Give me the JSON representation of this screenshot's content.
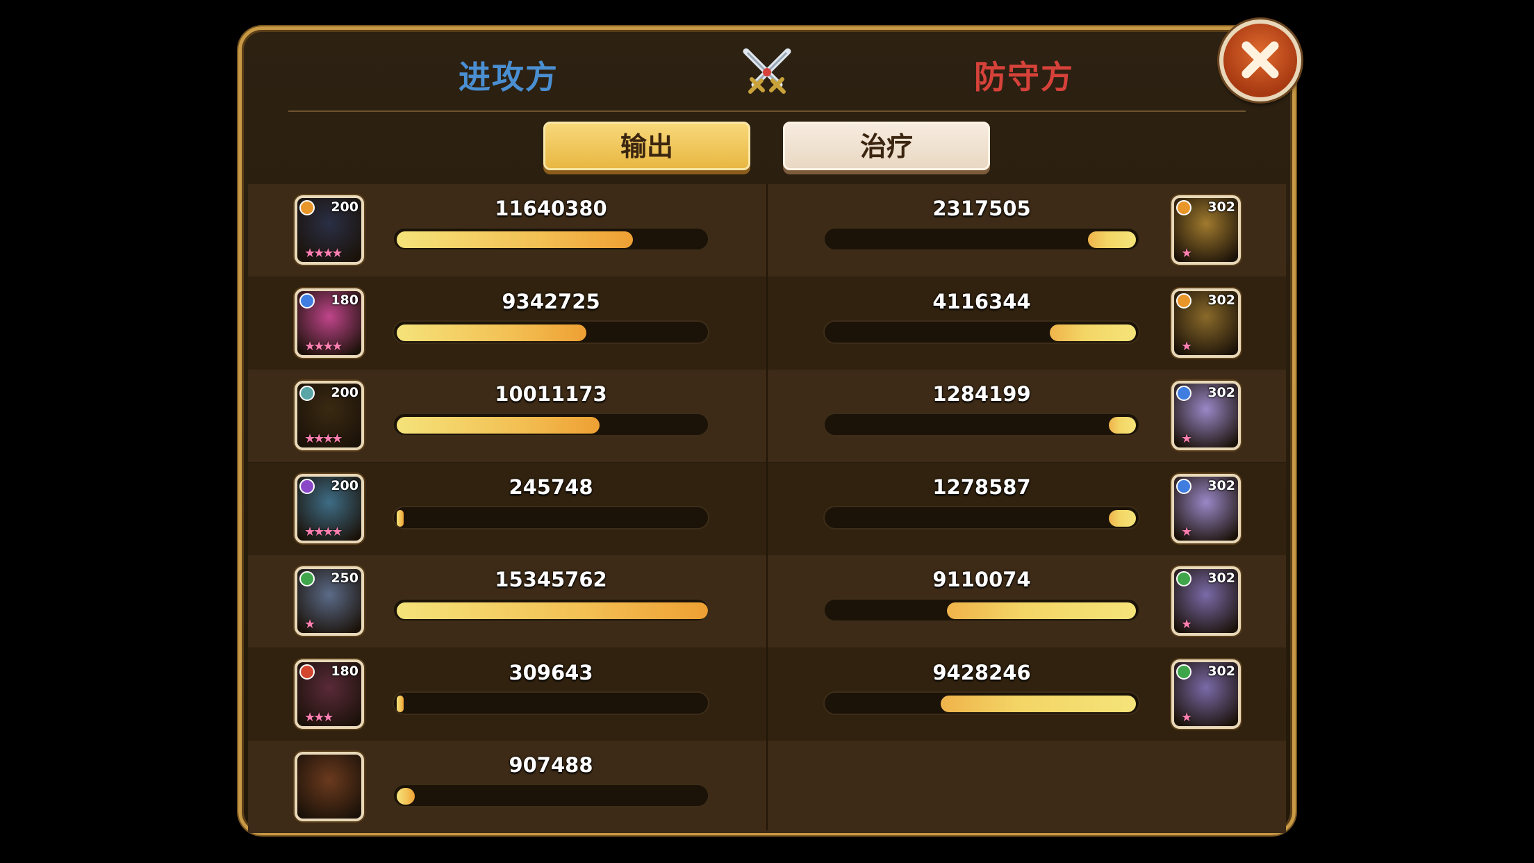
{
  "header": {
    "attacker_label": "进攻方",
    "defender_label": "防守方"
  },
  "tabs": {
    "output_label": "输出",
    "heal_label": "治疗",
    "selected": "输出"
  },
  "attackers": [
    {
      "value": "11640380",
      "fraction": 0.759,
      "level": "200",
      "stars": 4,
      "faction_color": "#e8962a",
      "portrait_color": "#2a2f45"
    },
    {
      "value": "9342725",
      "fraction": 0.609,
      "level": "180",
      "stars": 4,
      "faction_color": "#3f7ee0",
      "portrait_color": "#c0458b"
    },
    {
      "value": "10011173",
      "fraction": 0.652,
      "level": "200",
      "stars": 4,
      "faction_color": "#5aa6a6",
      "portrait_color": "#3a2a12"
    },
    {
      "value": "245748",
      "fraction": 0.016,
      "level": "200",
      "stars": 4,
      "faction_color": "#8a48c8",
      "portrait_color": "#3e6d86"
    },
    {
      "value": "15345762",
      "fraction": 1.0,
      "level": "250",
      "stars": 1,
      "faction_color": "#3fa54a",
      "portrait_color": "#5b6b88"
    },
    {
      "value": "309643",
      "fraction": 0.02,
      "level": "180",
      "stars": 3,
      "faction_color": "#d2452e",
      "portrait_color": "#5a2a3a"
    },
    {
      "value": "907488",
      "fraction": 0.059,
      "level": "",
      "stars": 0,
      "faction_color": "",
      "portrait_color": "#6b3a1e"
    }
  ],
  "defenders": [
    {
      "value": "2317505",
      "fraction": 0.155,
      "level": "302",
      "stars": 1,
      "faction_color": "#e8962a",
      "portrait_color": "#a07a2e"
    },
    {
      "value": "4116344",
      "fraction": 0.276,
      "level": "302",
      "stars": 1,
      "faction_color": "#e8962a",
      "portrait_color": "#8a6a2a"
    },
    {
      "value": "1284199",
      "fraction": 0.086,
      "level": "302",
      "stars": 1,
      "faction_color": "#3f7ee0",
      "portrait_color": "#9a88c8"
    },
    {
      "value": "1278587",
      "fraction": 0.086,
      "level": "302",
      "stars": 1,
      "faction_color": "#3f7ee0",
      "portrait_color": "#9a88c8"
    },
    {
      "value": "9110074",
      "fraction": 0.607,
      "level": "302",
      "stars": 1,
      "faction_color": "#3fa54a",
      "portrait_color": "#7a6aa8"
    },
    {
      "value": "9428246",
      "fraction": 0.628,
      "level": "302",
      "stars": 1,
      "faction_color": "#3fa54a",
      "portrait_color": "#7a6aa8"
    }
  ],
  "icons": {
    "close": "close-icon",
    "crossed_swords": "crossed-swords-icon"
  }
}
